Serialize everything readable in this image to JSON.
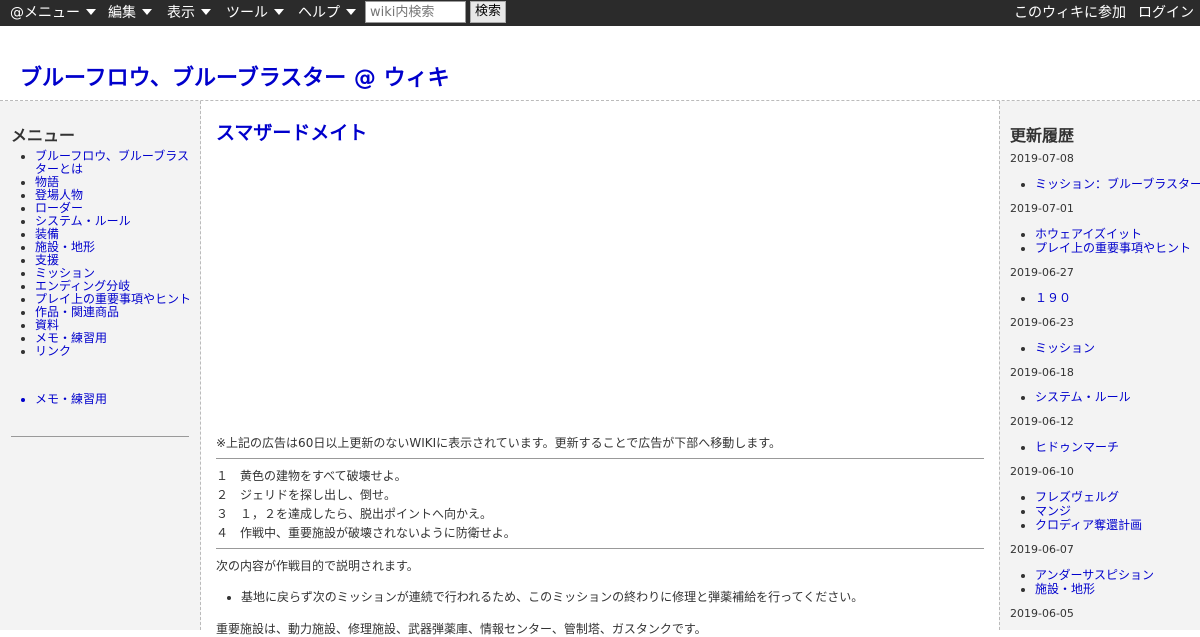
{
  "toolbar": {
    "menu_label": "@メニュー",
    "edit_label": "編集",
    "view_label": "表示",
    "tools_label": "ツール",
    "help_label": "ヘルプ",
    "search_placeholder": "wiki内検索",
    "search_button": "検索",
    "join_label": "このウィキに参加",
    "login_label": "ログイン"
  },
  "site": {
    "title": "ブルーフロウ、ブルーブラスター @ ウィキ"
  },
  "left_menu": {
    "heading": "メニュー",
    "items": [
      "ブルーフロウ、ブルーブラスターとは",
      "物語",
      "登場人物",
      "ローダー",
      "システム・ルール",
      "装備",
      "施設・地形",
      "支援",
      "ミッション",
      "エンディング分岐",
      "プレイ上の重要事項やヒント",
      "作品・関連商品",
      "資料",
      "メモ・練習用",
      "リンク"
    ],
    "extra_items": [
      "メモ・練習用"
    ]
  },
  "main": {
    "page_title": "スマザードメイト",
    "ad_notice": "※上記の広告は60日以上更新のないWIKIに表示されています。更新することで広告が下部へ移動します。",
    "objectives": [
      {
        "num": "１",
        "text": "黄色の建物をすべて破壊せよ。"
      },
      {
        "num": "２",
        "text": "ジェリドを探し出し、倒せ。"
      },
      {
        "num": "３",
        "text": "１，２を達成したら、脱出ポイントへ向かえ。"
      },
      {
        "num": "４",
        "text": "作戦中、重要施設が破壊されないように防衛せよ。"
      }
    ],
    "explanation_intro": "次の内容が作戦目的で説明されます。",
    "bullets": [
      "基地に戻らず次のミッションが連続で行われるため、このミッションの終わりに修理と弾薬補給を行ってください。"
    ],
    "facilities_line": "重要施設は、動力施設、修理施設、武器弾薬庫、情報センター、管制塔、ガスタンクです。"
  },
  "recent": {
    "heading": "更新履歴",
    "groups": [
      {
        "date": "2019-07-08",
        "items": [
          "ミッション：ブルーブラスター"
        ]
      },
      {
        "date": "2019-07-01",
        "items": [
          "ホウェアイズイット",
          "プレイ上の重要事項やヒント"
        ]
      },
      {
        "date": "2019-06-27",
        "items": [
          "１９０"
        ]
      },
      {
        "date": "2019-06-23",
        "items": [
          "ミッション"
        ]
      },
      {
        "date": "2019-06-18",
        "items": [
          "システム・ルール"
        ]
      },
      {
        "date": "2019-06-12",
        "items": [
          "ヒドゥンマーチ"
        ]
      },
      {
        "date": "2019-06-10",
        "items": [
          "フレズヴェルグ",
          "マンジ",
          "クロディア奪還計画"
        ]
      },
      {
        "date": "2019-06-07",
        "items": [
          "アンダーサスピション",
          "施設・地形"
        ]
      },
      {
        "date": "2019-06-05",
        "items": []
      }
    ]
  }
}
